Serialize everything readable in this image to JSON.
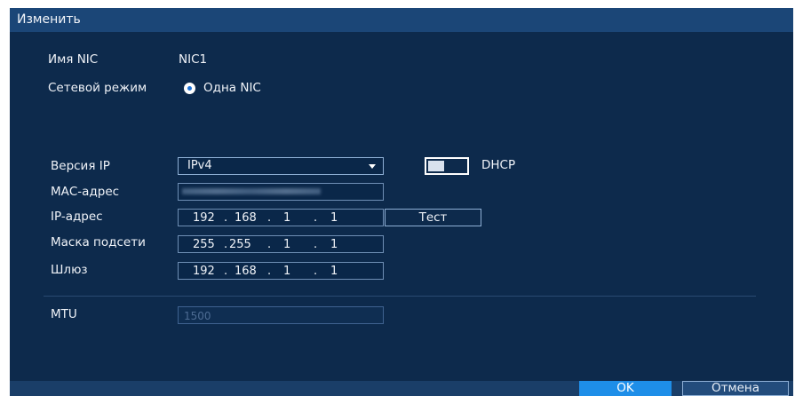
{
  "window": {
    "title": "Изменить"
  },
  "form": {
    "nic_name_label": "Имя NIC",
    "nic_name_value": "NIC1",
    "network_mode_label": "Сетевой режим",
    "network_mode_option": "Одна NIC",
    "ip_version_label": "Версия IP",
    "ip_version_value": "IPv4",
    "dhcp_label": "DHCP",
    "dhcp_enabled": false,
    "mac_label": "МАС-адрес",
    "ip_label": "IP-адрес",
    "ip": [
      "192",
      "168",
      "1",
      "1"
    ],
    "test_button": "Тест",
    "mask_label": "Маска подсети",
    "mask": [
      "255",
      "255",
      "1",
      "1"
    ],
    "gateway_label": "Шлюз",
    "gateway": [
      "192",
      "168",
      "1",
      "1"
    ],
    "mtu_label": "MTU",
    "mtu_placeholder": "1500"
  },
  "footer": {
    "ok": "OK",
    "cancel": "Отмена"
  },
  "colors": {
    "background": "#0d2a4c",
    "titlebar": "#1b4677",
    "accent": "#1e8ee8"
  }
}
